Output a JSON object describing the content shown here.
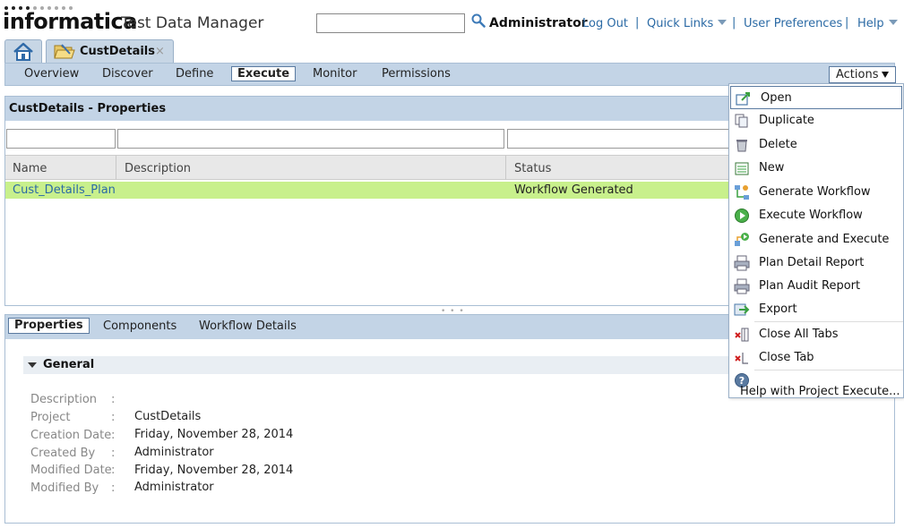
{
  "header": {
    "brand": "informatica",
    "product": "Test Data Manager",
    "search": {
      "value": "",
      "placeholder": ""
    },
    "user": "Administrator",
    "links": {
      "logout": "Log Out",
      "quick_links": "Quick Links",
      "user_preferences": "User Preferences",
      "help": "Help"
    },
    "separator": "|"
  },
  "tabs": {
    "doc_tab": {
      "title": "CustDetails",
      "close": "×"
    }
  },
  "nav": {
    "items": [
      "Overview",
      "Discover",
      "Define",
      "Execute",
      "Monitor",
      "Permissions"
    ],
    "active": "Execute",
    "actions_label": "Actions"
  },
  "properties": {
    "title": "CustDetails - Properties",
    "columns": [
      "Name",
      "Description",
      "Status"
    ],
    "rows": [
      {
        "name": "Cust_Details_Plan",
        "description": "",
        "status": "Workflow Generated"
      }
    ]
  },
  "bottom": {
    "tabs": [
      "Properties",
      "Components",
      "Workflow Details"
    ],
    "active_tab": "Properties",
    "section_title": "General",
    "fields": [
      {
        "label": "Description",
        "value": ""
      },
      {
        "label": "Project",
        "value": "CustDetails"
      },
      {
        "label": "Creation Date",
        "value": "Friday, November 28, 2014"
      },
      {
        "label": "Created By",
        "value": "Administrator"
      },
      {
        "label": "Modified Date",
        "value": "Friday, November 28, 2014"
      },
      {
        "label": "Modified By",
        "value": "Administrator"
      }
    ],
    "colon": ":"
  },
  "menu": {
    "items": [
      {
        "label": "Open",
        "icon": "open-icon"
      },
      {
        "label": "Duplicate",
        "icon": "duplicate-icon"
      },
      {
        "label": "Delete",
        "icon": "trash-icon"
      },
      {
        "label": "New",
        "icon": "new-icon"
      },
      {
        "label": "Generate Workflow",
        "icon": "generate-workflow-icon"
      },
      {
        "label": "Execute Workflow",
        "icon": "play-icon"
      },
      {
        "label": "Generate and Execute",
        "icon": "generate-execute-icon"
      },
      {
        "label": "Plan Detail Report",
        "icon": "printer-icon"
      },
      {
        "label": "Plan Audit Report",
        "icon": "printer-icon"
      },
      {
        "label": "Export",
        "icon": "export-icon"
      },
      {
        "label": "Close All Tabs",
        "icon": "close-all-tabs-icon"
      },
      {
        "label": "Close Tab",
        "icon": "close-tab-icon"
      },
      {
        "label": "Help with Project Execute...",
        "icon": "help-icon"
      }
    ],
    "highlighted": "Open"
  },
  "colors": {
    "nav_bg": "#c3d4e6",
    "row_highlight": "#c8f08c",
    "link": "#2b6aa5"
  }
}
